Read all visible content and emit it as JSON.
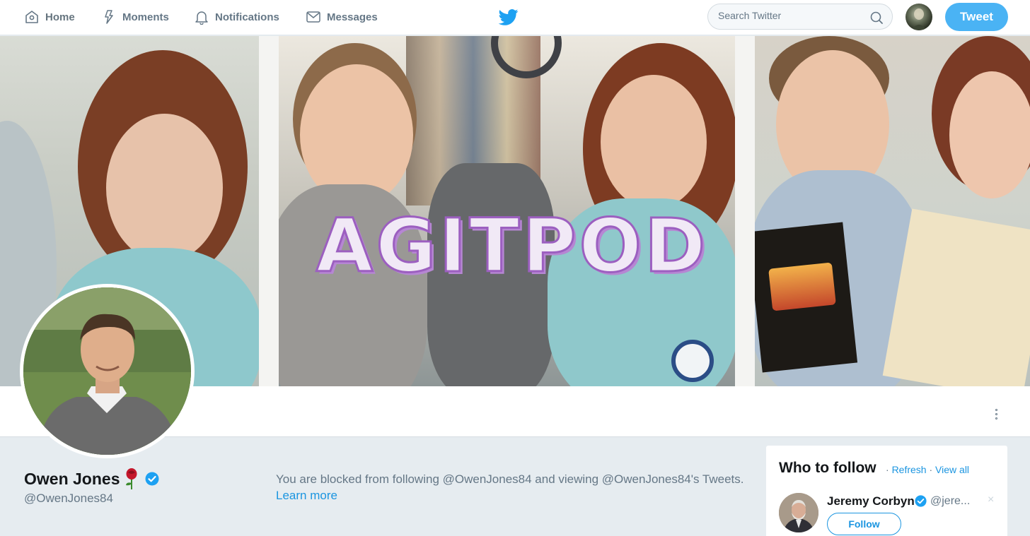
{
  "nav": {
    "home": "Home",
    "moments": "Moments",
    "notifications": "Notifications",
    "messages": "Messages",
    "search_placeholder": "Search Twitter",
    "tweet_button": "Tweet",
    "brand_color": "#1da1f2"
  },
  "banner": {
    "overlay_text": "AGITPOD"
  },
  "profile": {
    "name": "Owen Jones",
    "handle": "@OwenJones84",
    "verified": true
  },
  "blocked_notice": {
    "message": "You are blocked from following @OwenJones84 and viewing @OwenJones84's Tweets.",
    "learn_more": "Learn more"
  },
  "who_to_follow": {
    "title": "Who to follow",
    "separator": " · ",
    "refresh": "Refresh",
    "view_all": "View all",
    "suggestions": [
      {
        "name": "Jeremy Corbyn",
        "handle": "@jere...",
        "verified": true,
        "follow_label": "Follow",
        "close": "×"
      }
    ]
  }
}
